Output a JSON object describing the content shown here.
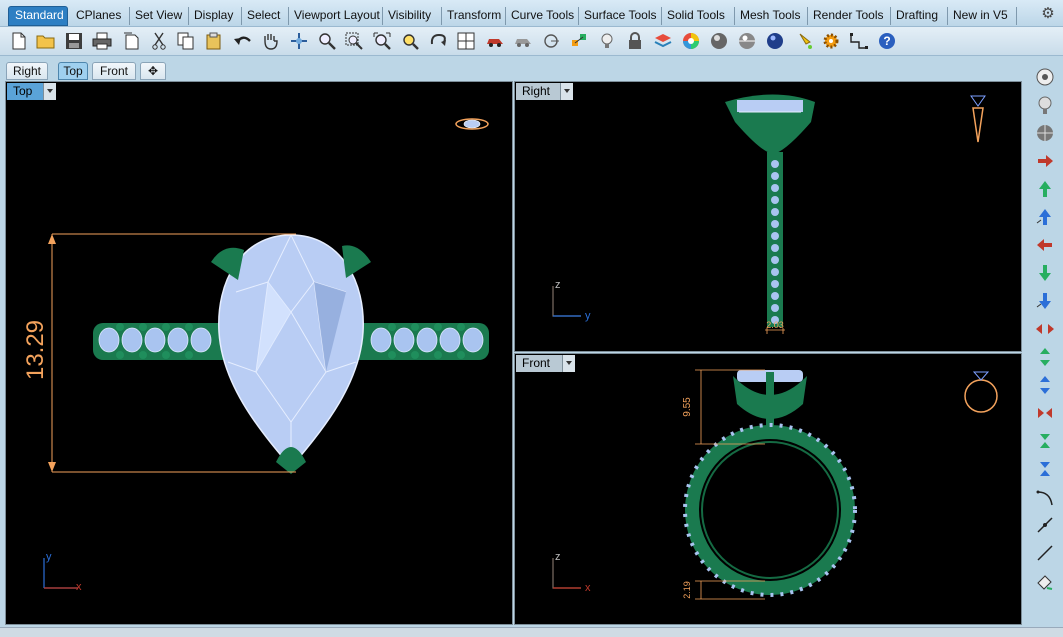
{
  "tabs": [
    {
      "label": "Standard",
      "active": true
    },
    {
      "label": "CPlanes"
    },
    {
      "label": "Set View"
    },
    {
      "label": "Display"
    },
    {
      "label": "Select"
    },
    {
      "label": "Viewport Layout"
    },
    {
      "label": "Visibility"
    },
    {
      "label": "Transform"
    },
    {
      "label": "Curve Tools"
    },
    {
      "label": "Surface Tools"
    },
    {
      "label": "Solid Tools"
    },
    {
      "label": "Mesh Tools"
    },
    {
      "label": "Render Tools"
    },
    {
      "label": "Drafting"
    },
    {
      "label": "New in V5"
    }
  ],
  "toolbar_icons": [
    "new-document-icon",
    "open-folder-icon",
    "save-icon",
    "print-icon",
    "import-icon",
    "cut-icon",
    "copy-icon",
    "paste-icon",
    "undo-icon",
    "pan-hand-icon",
    "rotate-view-icon",
    "zoom-icon",
    "zoom-window-icon",
    "zoom-extents-icon",
    "zoom-selected-icon",
    "rotate-arrow-icon",
    "four-viewports-icon",
    "car-icon",
    "dim-car-icon",
    "cplane-icon",
    "point-icon",
    "light-bulb-icon",
    "lock-icon",
    "layer-icon",
    "color-wheel-icon",
    "shaded-sphere-icon",
    "rendered-sphere-icon",
    "blue-sphere-icon",
    "paint-icon",
    "settings-gear-icon",
    "grid-snap-icon",
    "help-icon"
  ],
  "viewport_tabs": [
    {
      "label": "Right"
    },
    {
      "label": "Top",
      "active": true
    },
    {
      "label": "Front"
    },
    {
      "label": "✥"
    }
  ],
  "viewports": {
    "top": {
      "label": "Top",
      "dimension": "13.29",
      "axis_x": "x",
      "axis_y": "y"
    },
    "right": {
      "label": "Right",
      "dimension": "2.03",
      "axis_h": "y",
      "axis_v": "z"
    },
    "front": {
      "label": "Front",
      "dimension_top": "9.55",
      "dimension_bottom": "2.19",
      "axis_h": "x",
      "axis_v": "z"
    }
  },
  "right_toolbar_icons": [
    "camera-target-icon",
    "light-icon",
    "sphere-icon",
    "move-right-arrow-icon",
    "move-up-arrow-icon",
    "move-up-blue-icon",
    "move-left-arrow-icon",
    "move-down-arrow-icon",
    "move-down-blue-icon",
    "scale-horizontal-icon",
    "scale-vertical-icon",
    "scale-blue-icon",
    "shrink-horizontal-icon",
    "shrink-vertical-icon",
    "shrink-blue-icon",
    "arc-tool-icon",
    "line-point-icon",
    "line-tool-icon",
    "eraser-icon"
  ],
  "colors": {
    "accent": "#2d7fc3",
    "viewport_bg": "#000000",
    "gem": "#b9cdf4",
    "metal": "#1a7a4f",
    "dimension": "#f3a25c"
  }
}
